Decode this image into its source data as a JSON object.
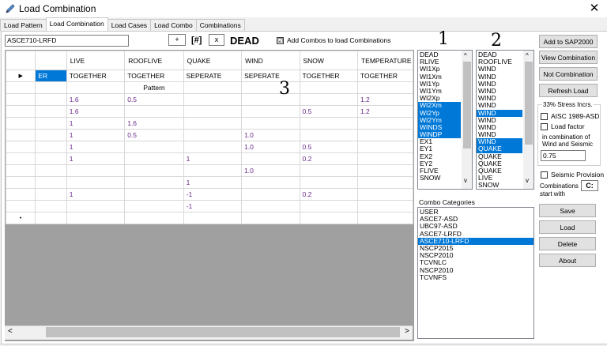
{
  "window": {
    "title": "Load Combination",
    "close": "✕"
  },
  "tabs": [
    "Load Pattern",
    "Load Combination",
    "Load Cases",
    "Load Combo",
    "Combinations"
  ],
  "top": {
    "combo_name": "ASCE710-LRFD",
    "plus": "+",
    "bracket": "[#]",
    "x": "x",
    "dead": "DEAD",
    "add_combos_label": "Add Combos to load Combinations",
    "add_combos_checked": "☑"
  },
  "grid": {
    "columns": [
      "LIVE",
      "ROOFLIVE",
      "QUAKE",
      "WIND",
      "SNOW",
      "TEMPERATURE"
    ],
    "first_col_header": "",
    "row_indicator": "▶",
    "new_row": "•",
    "type_row": {
      "first": "ER",
      "cells": [
        "TOGETHER",
        "TOGETHER",
        "SEPERATE",
        "SEPERATE",
        "TOGETHER",
        "TOGETHER"
      ]
    },
    "rows": [
      [
        "",
        "",
        "Pattern",
        "",
        "",
        "",
        ""
      ],
      [
        "",
        "1.6",
        "0.5",
        "",
        "",
        "",
        "1.2"
      ],
      [
        "",
        "1.6",
        "",
        "",
        "",
        "0.5",
        "1.2"
      ],
      [
        "",
        "1",
        "1.6",
        "",
        "",
        "",
        ""
      ],
      [
        "",
        "1",
        "0.5",
        "",
        "1.0",
        "",
        ""
      ],
      [
        "",
        "1",
        "",
        "",
        "1.0",
        "0.5",
        ""
      ],
      [
        "",
        "1",
        "",
        "1",
        "",
        "0.2",
        ""
      ],
      [
        "",
        "",
        "",
        "",
        "1.0",
        "",
        ""
      ],
      [
        "",
        "",
        "",
        "1",
        "",
        "",
        ""
      ],
      [
        "",
        "1",
        "",
        "-1",
        "",
        "0.2",
        ""
      ],
      [
        "",
        "",
        "",
        "-1",
        "",
        "",
        ""
      ]
    ],
    "scroll_left": "<",
    "scroll_right": ">"
  },
  "annotations": {
    "one": "1",
    "two": "2",
    "three": "3"
  },
  "list1": {
    "items": [
      "DEAD",
      "RLIVE",
      "WI1Xp",
      "WI1Xm",
      "WI1Yp",
      "WI1Ym",
      "WI2Xp",
      "WI2Xm",
      "WI2Yp",
      "WI2Ym",
      "WINDS",
      "WINDP",
      "EX1",
      "EY1",
      "EX2",
      "EY2",
      "FLIVE",
      "SNOW"
    ],
    "selected": [
      7,
      8,
      9,
      10,
      11
    ]
  },
  "list2": {
    "items": [
      "DEAD",
      "ROOFLIVE",
      "WIND",
      "WIND",
      "WIND",
      "WIND",
      "WIND",
      "WIND",
      "WIND",
      "WIND",
      "WIND",
      "WIND",
      "WIND",
      "QUAKE",
      "QUAKE",
      "QUAKE",
      "QUAKE",
      "LIVE",
      "SNOW"
    ],
    "selected": [
      8,
      12,
      13
    ]
  },
  "scroll": {
    "up": "^",
    "down": "v"
  },
  "combo_categories": {
    "label": "Combo Categories",
    "items": [
      "USER",
      "ASCE7-ASD",
      "UBC97-ASD",
      "ASCE7-LRFD",
      "ASCE710-LRFD",
      "NSCP2015",
      "NSCP2010",
      "TCVNLC",
      "NSCP2010",
      "TCVNFS"
    ],
    "selected": 4
  },
  "right": {
    "add_to_sap": "Add to SAP2000",
    "view_combination": "View Combination",
    "not_combination": "Not Combination",
    "refresh_load": "Refresh Load",
    "stress_group": "33% Stress Incrs.",
    "aisc_label": "AISC 1989-ASD",
    "load_factor_label": "Load factor",
    "in_combination_text": "in combination of Wind and Seismic",
    "factor_value": "0.75",
    "seismic_label": "Seismic Provision",
    "combinations_start_label": "Combinations start with",
    "start_value": "C:",
    "save": "Save",
    "load": "Load",
    "delete": "Delete",
    "about": "About"
  }
}
